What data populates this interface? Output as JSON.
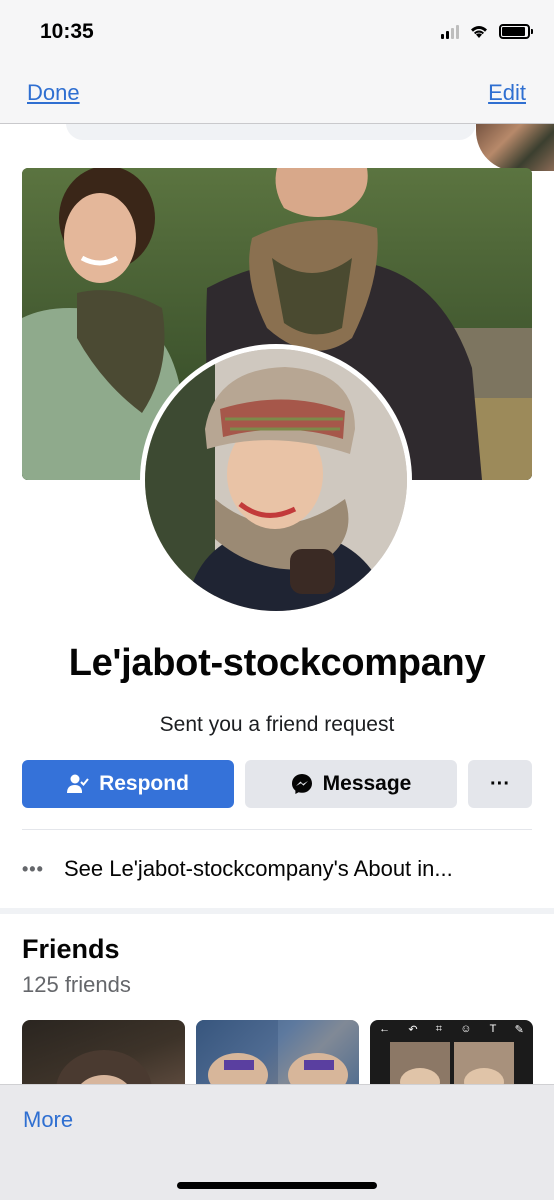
{
  "status_bar": {
    "time": "10:35",
    "icons": [
      "cellular-signal-icon",
      "wifi-icon",
      "battery-icon"
    ],
    "battery_level": 0.9
  },
  "nav": {
    "done_label": "Done",
    "edit_label": "Edit"
  },
  "profile": {
    "name": "Le'jabot-stockcompany",
    "subtitle": "Sent you a friend request"
  },
  "actions": {
    "respond_label": "Respond",
    "respond_icon": "person-check-icon",
    "message_label": "Message",
    "message_icon": "messenger-icon",
    "more_label": "···",
    "more_icon": "ellipsis-icon"
  },
  "about": {
    "text": "See Le'jabot-stockcompany's About in..."
  },
  "friends": {
    "title": "Friends",
    "count_text": "125 friends"
  },
  "bottom_bar": {
    "more_label": "More"
  },
  "colors": {
    "accent_blue": "#2f6fd1",
    "respond_blue": "#3572d9",
    "secondary_button": "#e4e6eb",
    "muted_text": "#65676b"
  }
}
